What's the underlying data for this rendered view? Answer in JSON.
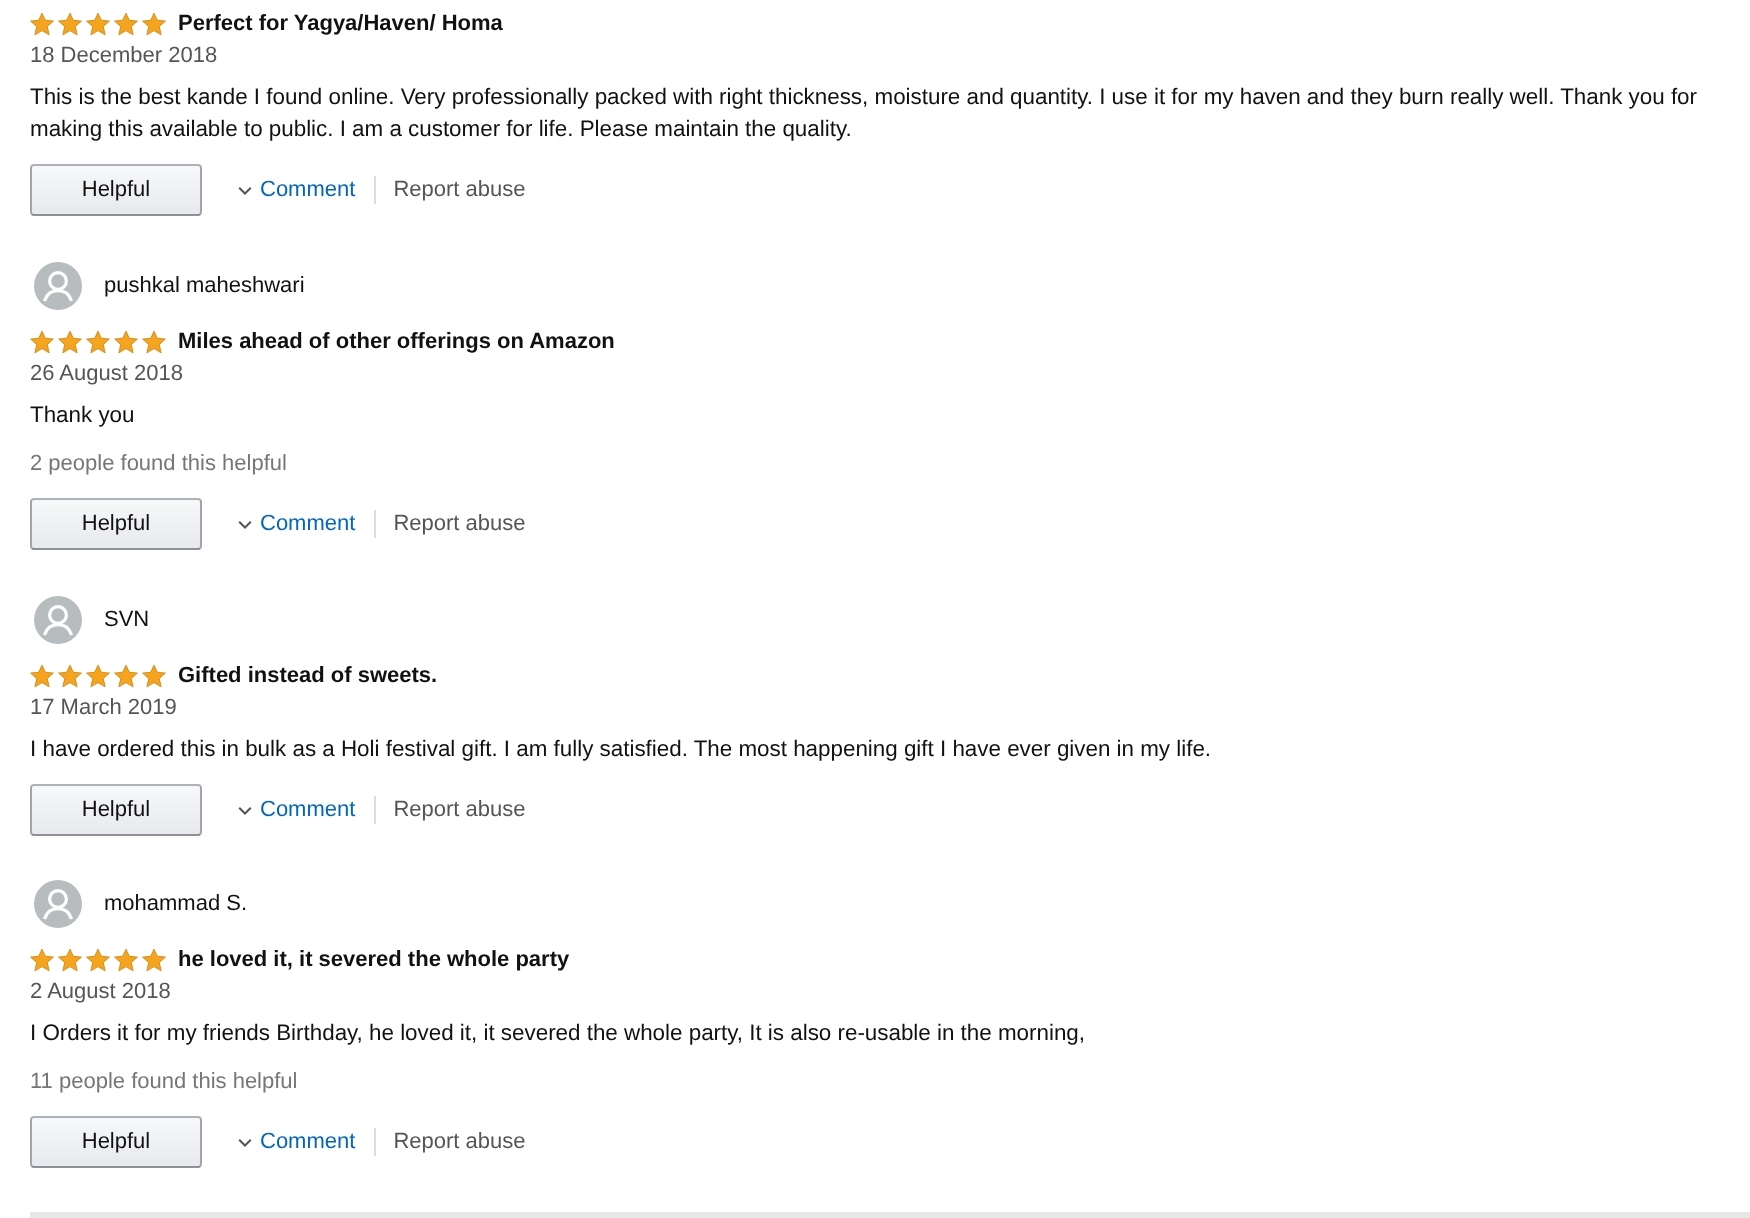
{
  "reviews": [
    {
      "stars": 5,
      "title": "Perfect for Yagya/Haven/ Homa",
      "date": "18 December 2018",
      "body": "This is the best kande I found online. Very professionally packed with right thickness, moisture and quantity. I use it for my haven and they burn really well. Thank you for making this available to public. I am a customer for life. Please maintain the quality.",
      "helpful_button": "Helpful",
      "comment_link": "Comment",
      "report_link": "Report abuse"
    },
    {
      "author": "pushkal maheshwari",
      "stars": 5,
      "title": "Miles ahead of other offerings on Amazon",
      "date": "26 August 2018",
      "body": "Thank you",
      "helpful_count": "2 people found this helpful",
      "helpful_button": "Helpful",
      "comment_link": "Comment",
      "report_link": "Report abuse"
    },
    {
      "author": "SVN",
      "stars": 5,
      "title": "Gifted instead of sweets.",
      "date": "17 March 2019",
      "body": "I have ordered this in bulk as a Holi festival gift. I am fully satisfied. The most happening gift I have ever given in my life.",
      "helpful_button": "Helpful",
      "comment_link": "Comment",
      "report_link": "Report abuse"
    },
    {
      "author": "mohammad S.",
      "stars": 5,
      "title": "he loved it, it severed the whole party",
      "date": "2 August 2018",
      "body": "I Orders it for my friends Birthday, he loved it, it severed the whole party, It is also re-usable in the morning,",
      "helpful_count": "11 people found this helpful",
      "helpful_button": "Helpful",
      "comment_link": "Comment",
      "report_link": "Report abuse"
    }
  ]
}
